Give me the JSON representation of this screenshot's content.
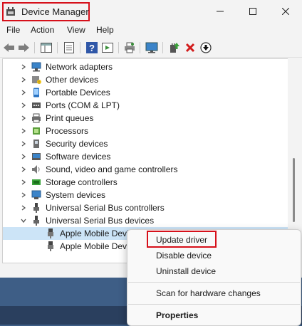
{
  "window": {
    "title": "Device Manager",
    "controls": {
      "minimize": "—",
      "maximize": "☐",
      "close": "✕"
    }
  },
  "menu": [
    "File",
    "Action",
    "View",
    "Help"
  ],
  "tree": {
    "items": [
      {
        "label": "Network adapters",
        "icon": "network-adapter-icon"
      },
      {
        "label": "Other devices",
        "icon": "other-devices-icon"
      },
      {
        "label": "Portable Devices",
        "icon": "portable-devices-icon"
      },
      {
        "label": "Ports (COM & LPT)",
        "icon": "ports-icon"
      },
      {
        "label": "Print queues",
        "icon": "printer-icon"
      },
      {
        "label": "Processors",
        "icon": "processor-icon"
      },
      {
        "label": "Security devices",
        "icon": "security-devices-icon"
      },
      {
        "label": "Software devices",
        "icon": "software-devices-icon"
      },
      {
        "label": "Sound, video and game controllers",
        "icon": "speaker-icon"
      },
      {
        "label": "Storage controllers",
        "icon": "storage-controller-icon"
      },
      {
        "label": "System devices",
        "icon": "system-devices-icon"
      },
      {
        "label": "Universal Serial Bus controllers",
        "icon": "usb-icon"
      },
      {
        "label": "Universal Serial Bus devices",
        "icon": "usb-icon",
        "expanded": true
      },
      {
        "label": "Apple Mobile Devi",
        "icon": "usb-device-icon",
        "child": true,
        "selected": true
      },
      {
        "label": "Apple Mobile Devi",
        "icon": "usb-device-icon",
        "child": true
      }
    ]
  },
  "context_menu": {
    "update_driver": "Update driver",
    "disable_device": "Disable device",
    "uninstall_device": "Uninstall device",
    "scan_hardware": "Scan for hardware changes",
    "properties": "Properties"
  },
  "colors": {
    "highlight_box": "#d6101a",
    "selection": "#cce4f7"
  }
}
